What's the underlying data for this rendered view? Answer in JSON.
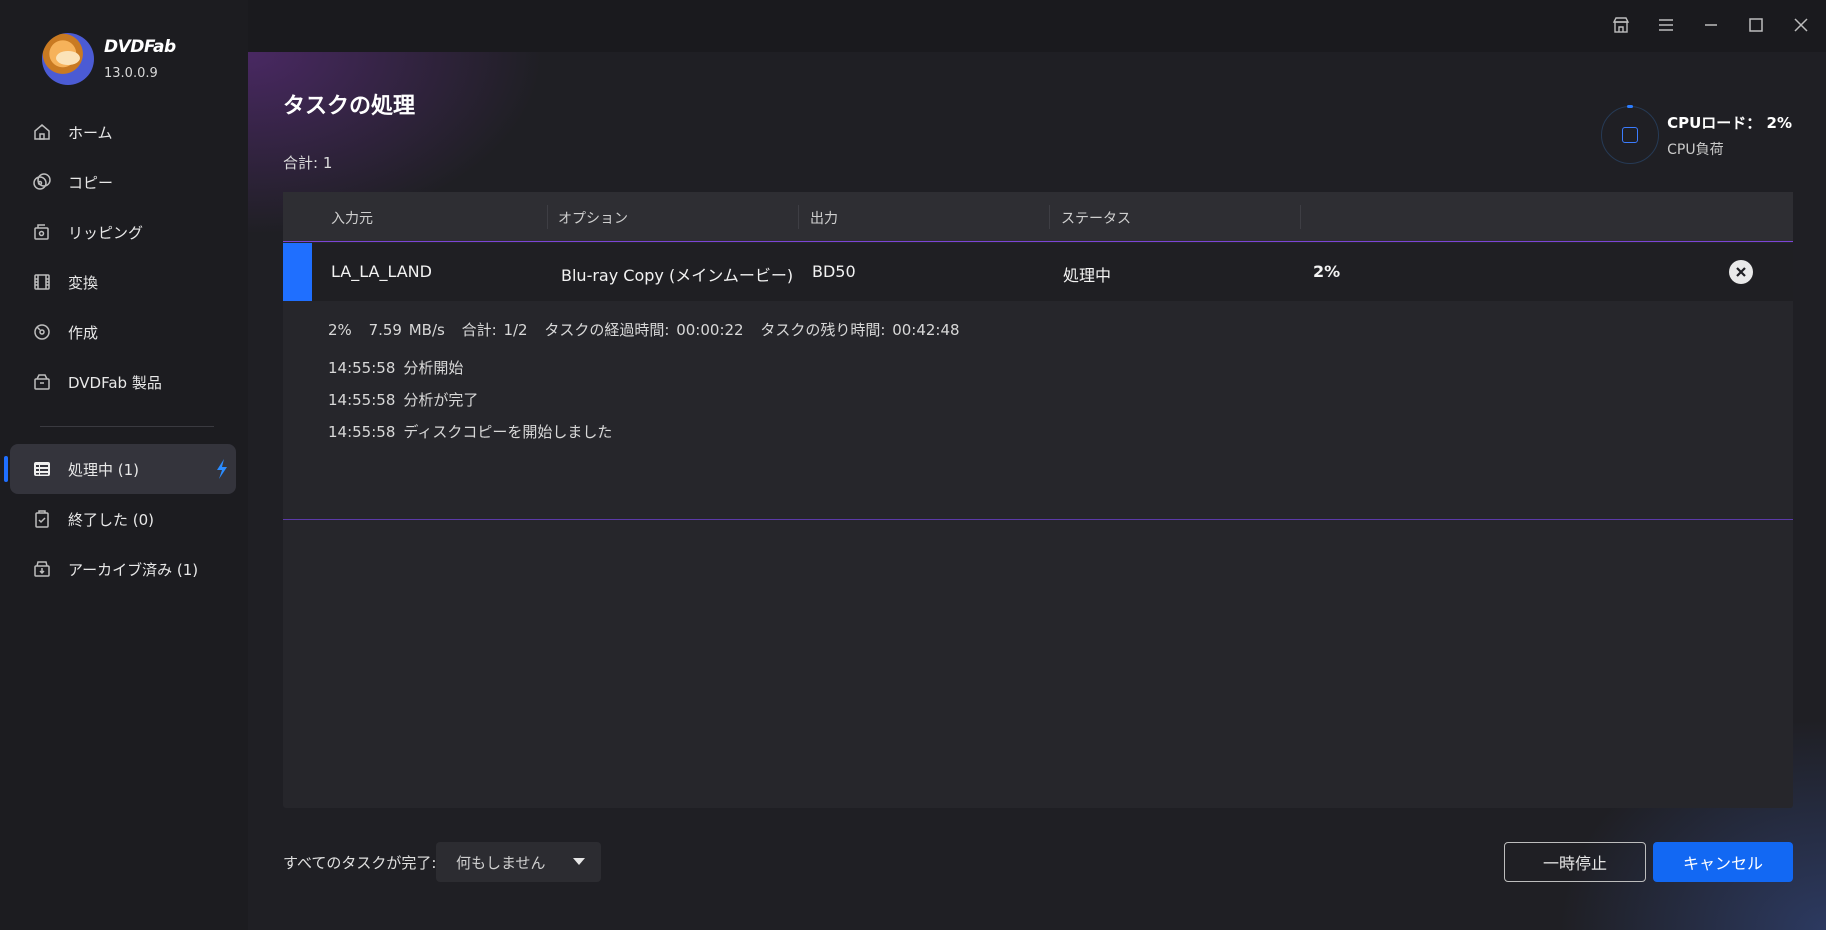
{
  "app": {
    "name": "DVDFab",
    "version": "13.0.0.9"
  },
  "sidebar": {
    "items": [
      {
        "label": "ホーム",
        "icon": "home-icon"
      },
      {
        "label": "コピー",
        "icon": "copy-icon"
      },
      {
        "label": "リッピング",
        "icon": "ripping-icon"
      },
      {
        "label": "変換",
        "icon": "film-icon"
      },
      {
        "label": "作成",
        "icon": "disc-create-icon"
      },
      {
        "label": "DVDFab 製品",
        "icon": "products-box-icon"
      }
    ],
    "tasks": [
      {
        "label": "処理中 (1)",
        "icon": "task-list-icon",
        "active": true
      },
      {
        "label": "終了した (0)",
        "icon": "clipboard-check-icon",
        "active": false
      },
      {
        "label": "アーカイブ済み (1)",
        "icon": "archive-icon",
        "active": false
      }
    ]
  },
  "main": {
    "title": "タスクの処理",
    "total": "合計: 1",
    "cpu": {
      "load": "CPUロード：  2%",
      "label": "CPU負荷"
    },
    "table": {
      "headers": [
        "入力元",
        "オプション",
        "出力",
        "ステータス"
      ],
      "row": {
        "source": "LA_LA_LAND",
        "option": "Blu-ray Copy (メインムービー)",
        "output": "BD50",
        "status": "処理中",
        "percent": "2%"
      },
      "progress": {
        "percent": "2%",
        "speed": "7.59 MB/s",
        "count": "合計: 1/2",
        "elapsed": "タスクの経過時間: 00:00:22",
        "remaining": "タスクの残り時間: 00:42:48"
      },
      "log": [
        {
          "time": "14:55:58",
          "message": "分析開始"
        },
        {
          "time": "14:55:58",
          "message": "分析が完了"
        },
        {
          "time": "14:55:58",
          "message": "ディスクコピーを開始しました"
        }
      ]
    }
  },
  "footer": {
    "after_label": "すべてのタスクが完了:",
    "after_value": "何もしません",
    "pause_label": "一時停止",
    "cancel_label": "キャンセル"
  },
  "colors": {
    "accent": "#1f6fff",
    "purple": "#7b44d6",
    "cancel": "#1268f3"
  }
}
